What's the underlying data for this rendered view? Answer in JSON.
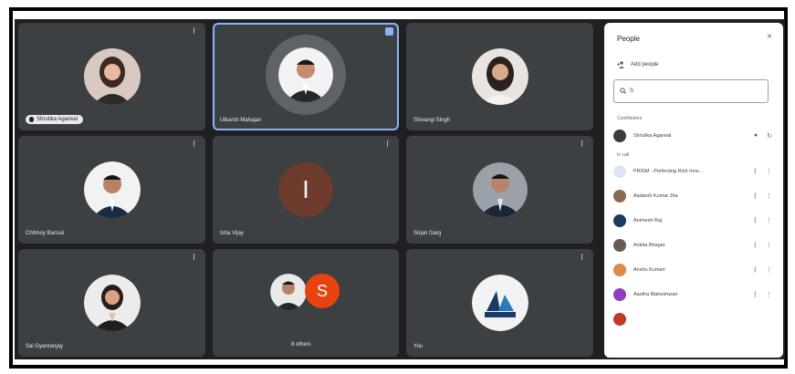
{
  "tiles": [
    {
      "name": "Shrutika Agarwal",
      "muted": true,
      "pill": true
    },
    {
      "name": "Utkarsh Mahajan",
      "muted": false,
      "pinned": true
    },
    {
      "name": "Shivangi Singh",
      "muted": false
    },
    {
      "name": "Chitmoy Bansal",
      "muted": true
    },
    {
      "name": "Isha Vijay",
      "muted": true,
      "initial": "I"
    },
    {
      "name": "Srijan Garg",
      "muted": true
    },
    {
      "name": "Sai Gyanranjay",
      "muted": true
    },
    {
      "name": "8 others",
      "muted": false,
      "initial": "S"
    },
    {
      "name": "You",
      "muted": true
    }
  ],
  "panel": {
    "title": "People",
    "close": "×",
    "add_label": "Add people",
    "search_value": "S",
    "section_contributors": "Contributors",
    "section_in_call": "In call",
    "participants": [
      {
        "name": "Shrutika Agarwal"
      },
      {
        "name": "PRISM - Perfecting Rich Innovative Solutions"
      },
      {
        "name": "Aadarsh Kumar Jha"
      },
      {
        "name": "Animesh Raj"
      },
      {
        "name": "Ankita Bhagat"
      },
      {
        "name": "Anshu Kumari"
      },
      {
        "name": "Aastha Maheshwari"
      }
    ]
  }
}
